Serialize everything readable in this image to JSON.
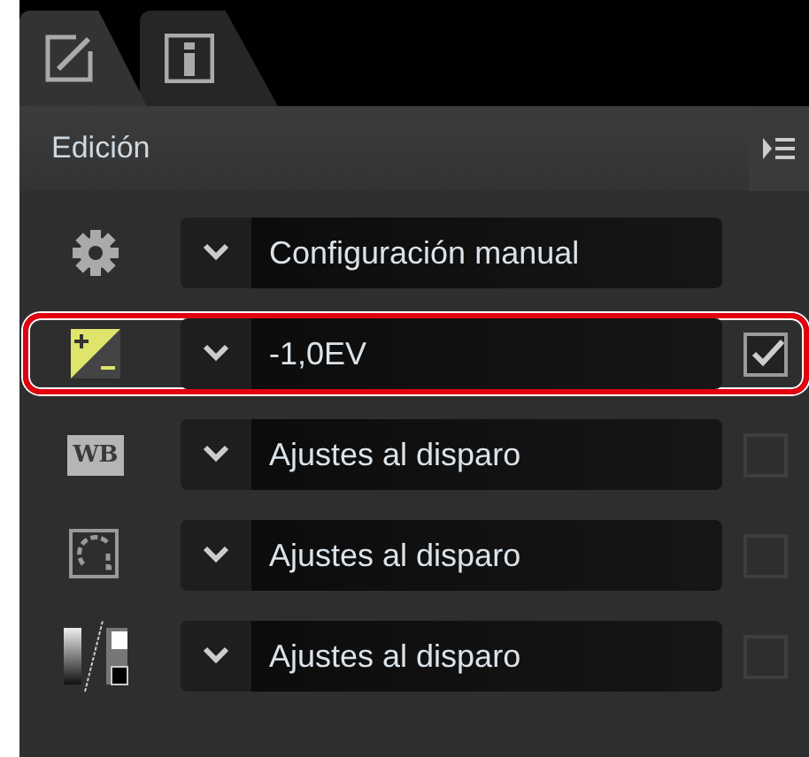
{
  "tabs": [
    {
      "kind": "edit",
      "selected": true
    },
    {
      "kind": "info",
      "selected": false
    }
  ],
  "panel": {
    "title": "Edición"
  },
  "rows": [
    {
      "kind": "gear",
      "value": "Configuración manual",
      "highlighted": false
    },
    {
      "kind": "exposure",
      "value": "-1,0EV",
      "checked": true,
      "highlighted": true
    },
    {
      "kind": "wb",
      "icon_text": "WB",
      "value": "Ajustes al disparo",
      "checked": false,
      "highlighted": false
    },
    {
      "kind": "picture",
      "value": "Ajustes al disparo",
      "checked": false,
      "highlighted": false
    },
    {
      "kind": "tone",
      "value": "Ajustes al disparo",
      "checked": false,
      "highlighted": false
    }
  ]
}
